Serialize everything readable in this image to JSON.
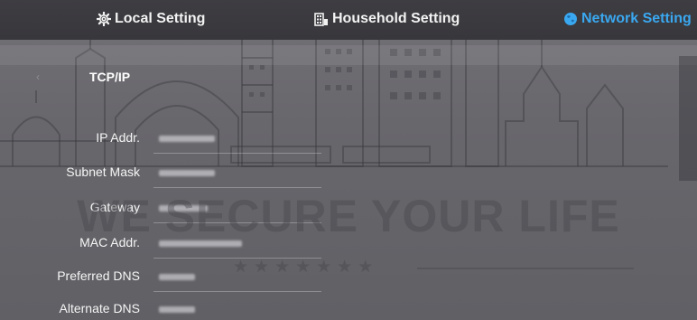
{
  "tabs": [
    {
      "label": "Local Setting",
      "icon": "gear-icon"
    },
    {
      "label": "Household Setting",
      "icon": "building-icon"
    },
    {
      "label": "Network Setting",
      "icon": "globe-icon",
      "active": true
    }
  ],
  "section": {
    "title": "TCP/IP"
  },
  "fields": [
    {
      "label": "IP Addr.",
      "value_state": "obscured"
    },
    {
      "label": "Subnet Mask",
      "value_state": "obscured"
    },
    {
      "label": "Gateway",
      "value_state": "obscured"
    },
    {
      "label": "MAC Addr.",
      "value_state": "obscured"
    },
    {
      "label": "Preferred DNS",
      "value_state": "obscured"
    },
    {
      "label": "Alternate DNS",
      "value_state": "obscured"
    }
  ],
  "watermark": {
    "text": "WE SECURE YOUR LIFE",
    "stars": "★★★★★★★"
  },
  "colors": {
    "active_tab": "#3aa8f0",
    "topbar": "#3d3c41",
    "panel": "#68676c"
  }
}
